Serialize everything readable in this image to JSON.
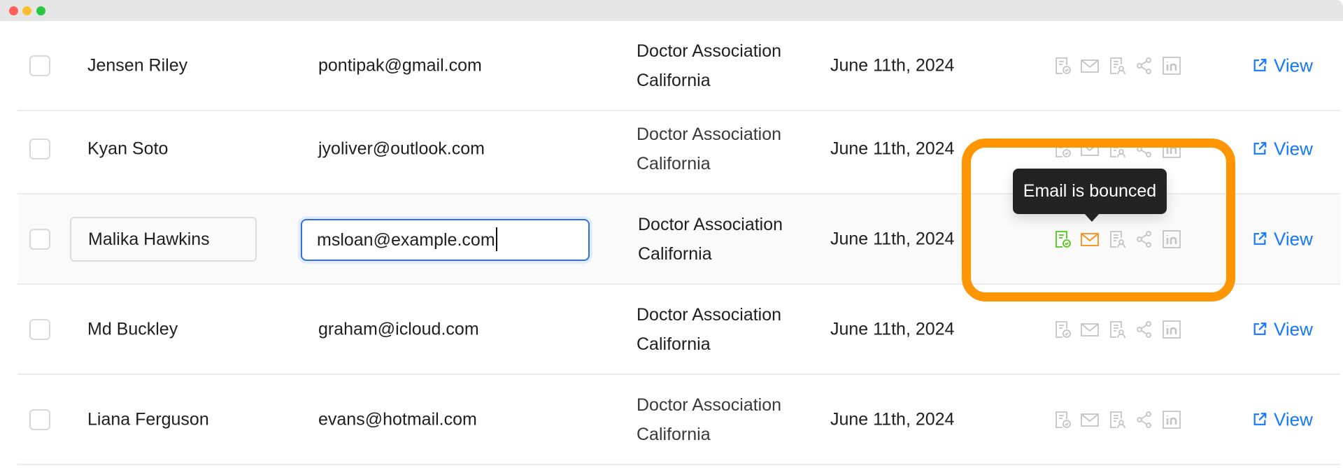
{
  "window": {
    "controls": [
      "close",
      "minimize",
      "maximize"
    ]
  },
  "rows": [
    {
      "name": "Jensen Riley",
      "email": "pontipak@gmail.com",
      "org_line1": "Doctor Association",
      "org_line2": "California",
      "date": "June 11th, 2024",
      "view_label": "View"
    },
    {
      "name": "Kyan Soto",
      "email": "jyoliver@outlook.com",
      "org_line1": "Doctor Association",
      "org_line2": "California",
      "date": "June 11th, 2024",
      "view_label": "View"
    },
    {
      "name": "Malika Hawkins",
      "email": "msloan@example.com",
      "org_line1": "Doctor Association",
      "org_line2": "California",
      "date": "June 11th, 2024",
      "view_label": "View",
      "editing": true
    },
    {
      "name": "Md Buckley",
      "email": "graham@icloud.com",
      "org_line1": "Doctor Association",
      "org_line2": "California",
      "date": "June 11th, 2024",
      "view_label": "View"
    },
    {
      "name": "Liana Ferguson",
      "email": "evans@hotmail.com",
      "org_line1": "Doctor Association",
      "org_line2": "California",
      "date": "June 11th, 2024",
      "view_label": "View"
    }
  ],
  "action_icons": [
    "document-check-icon",
    "mail-icon",
    "document-user-icon",
    "share-icon",
    "linkedin-icon"
  ],
  "tooltip": {
    "text": "Email is bounced"
  },
  "colors": {
    "icon_inactive": "#c4c4c4",
    "verified_green": "#52c41a",
    "bounced_orange": "#fa8c16",
    "highlight_orange": "#ff9500",
    "link_blue": "#1677ff",
    "focus_blue": "#2f6fed"
  }
}
